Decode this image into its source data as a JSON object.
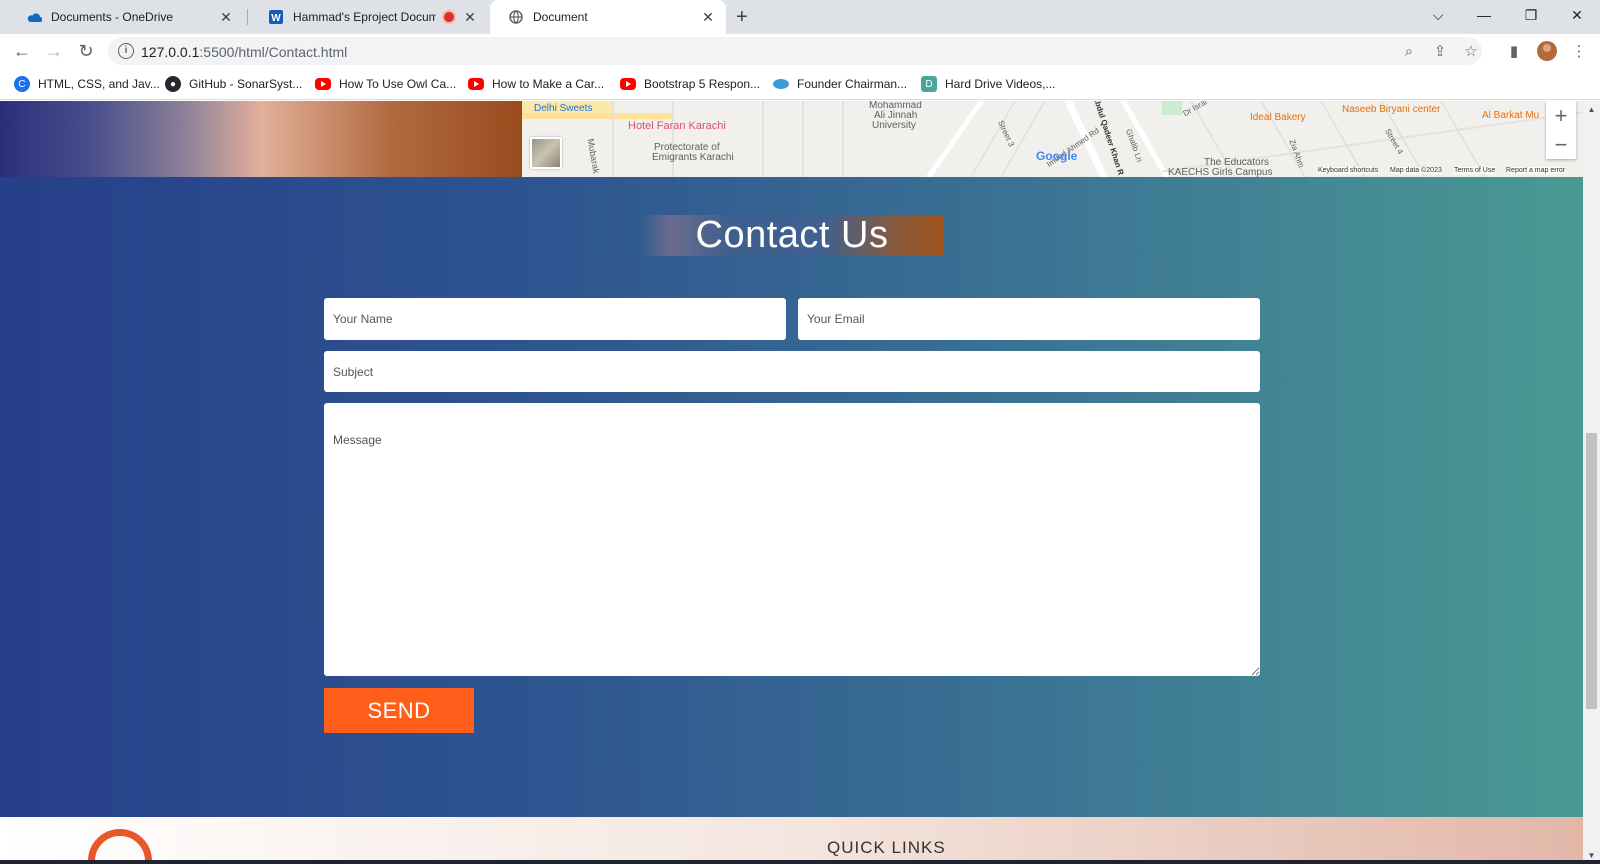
{
  "browser": {
    "tabs": [
      {
        "title": "Documents - OneDrive",
        "favicon": "onedrive-icon"
      },
      {
        "title": "Hammad's Eproject Docume",
        "favicon": "word-icon",
        "recording": true
      },
      {
        "title": "Document",
        "favicon": "globe-icon",
        "active": true
      }
    ],
    "new_tab": "+",
    "url_host": "127.0.0.1",
    "url_path": ":5500/html/Contact.html",
    "bookmarks": [
      {
        "label": "HTML, CSS, and Jav...",
        "icon": "c-icon"
      },
      {
        "label": "GitHub - SonarSyst...",
        "icon": "github-icon"
      },
      {
        "label": "How To Use Owl Ca...",
        "icon": "youtube-icon"
      },
      {
        "label": "How to Make a Car...",
        "icon": "youtube-icon"
      },
      {
        "label": "Bootstrap 5 Respon...",
        "icon": "youtube-icon"
      },
      {
        "label": "Founder Chairman...",
        "icon": "cloud-icon"
      },
      {
        "label": "Hard Drive Videos,...",
        "icon": "d-icon"
      }
    ]
  },
  "map": {
    "labels": {
      "delhi_sweets": "Delhi Sweets",
      "hotel": "Hotel Faran Karachi",
      "protectorate": "Protectorate of",
      "emigrants": "Emigrants Karachi",
      "mubarak": "Mubarak",
      "maju1": "Mohammad",
      "maju2": "Ali Jinnah",
      "maju3": "University",
      "street3": "Street 3",
      "abdul": "Abdul Qadeer Khan R",
      "ghalib": "Ghalib Ln",
      "ideal": "Ideal Bakery",
      "naseeb": "Naseeb Biryani center",
      "albarkat": "Al Barkat Mu",
      "educators": "The Educators",
      "kaechs": "KAECHS Girls Campus",
      "street4": "Street 4",
      "zia": "Zia Ahm",
      "google": "Google",
      "dr_israr": "Dr Israr",
      "imdad": "Imdad Ahmed Rd"
    },
    "footer": {
      "shortcuts": "Keyboard shortcuts",
      "data": "Map data ©2023",
      "terms": "Terms of Use",
      "report": "Report a map error"
    },
    "zoom_in": "+",
    "zoom_out": "−"
  },
  "contact": {
    "title": "Contact Us",
    "name_placeholder": "Your Name",
    "email_placeholder": "Your Email",
    "subject_placeholder": "Subject",
    "message_placeholder": "Message",
    "send_label": "SEND"
  },
  "footer": {
    "heading": "QUICK LINKS"
  },
  "colors": {
    "send_button": "#ff5e1a",
    "gradient_start": "#263f8a",
    "gradient_end": "#4a9a93"
  }
}
